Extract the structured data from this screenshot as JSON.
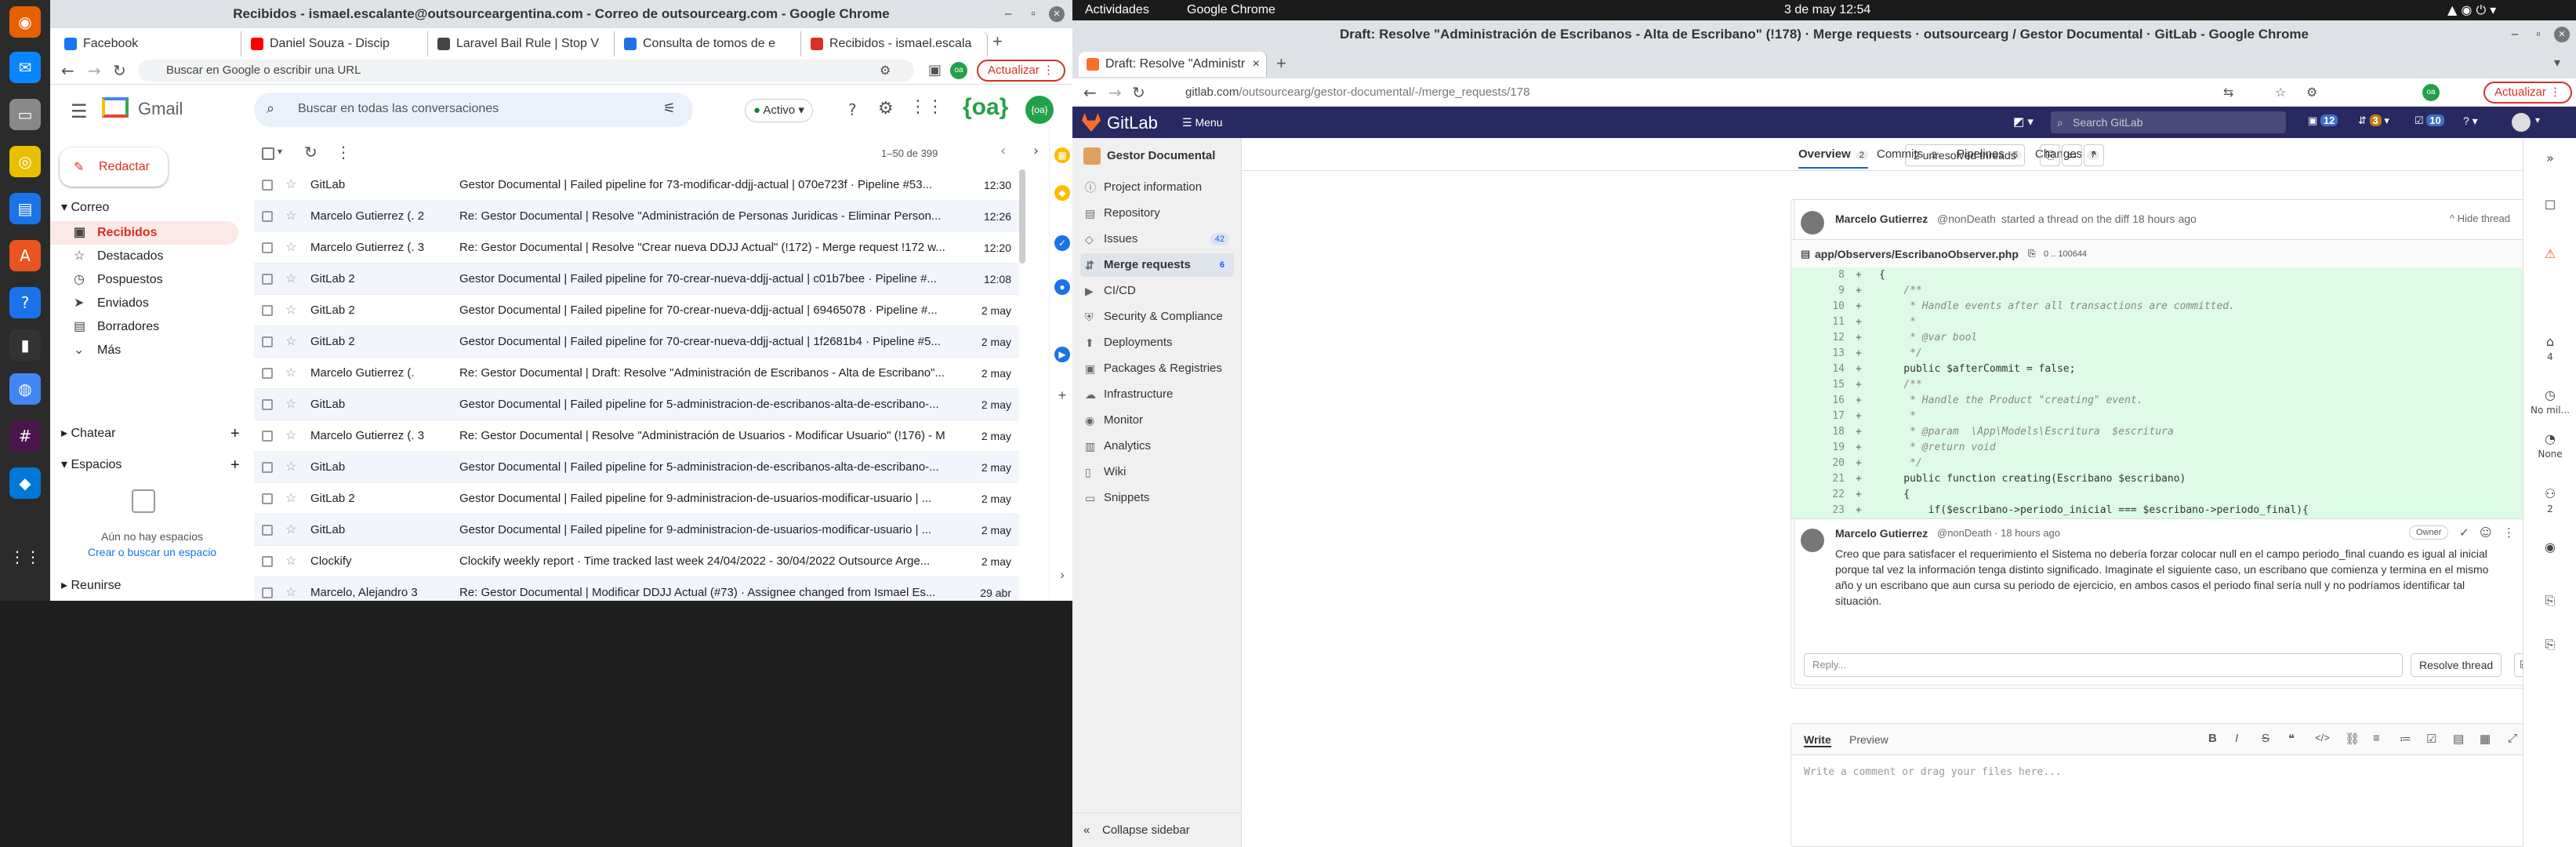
{
  "dock": {
    "icons": [
      "firefox-icon",
      "thunderbird-icon",
      "files-icon",
      "rhythmbox-icon",
      "libreoffice-icon",
      "software-icon",
      "help-icon",
      "terminal-icon",
      "chrome-icon",
      "slack-icon",
      "vscode-icon",
      "apps-grid-icon"
    ]
  },
  "gmail_window": {
    "title": "Recibidos - ismael.escalante@outsourceargentina.com - Correo de outsourcearg.com - Google Chrome",
    "tabs": [
      {
        "label": "Facebook",
        "color": "#1877f2"
      },
      {
        "label": "Daniel Souza - Discip",
        "color": "#ff0000"
      },
      {
        "label": "Laravel Bail Rule | Stop V",
        "color": "#444"
      },
      {
        "label": "Consulta de tomos de e",
        "color": "#1a73e8"
      },
      {
        "label": "Recibidos - ismael.escala",
        "color": "#d93025"
      }
    ],
    "address": "Buscar en Google o escribir una URL",
    "update_label": "Actualizar",
    "gmail_label": "Gmail",
    "search_placeholder": "Buscar en todas las conversaciones",
    "status": "Activo",
    "compose_label": "Redactar",
    "mail_header": "Correo",
    "pagination": "1–50 de 399",
    "folders": [
      "Recibidos",
      "Destacados",
      "Pospuestos",
      "Enviados",
      "Borradores",
      "Más"
    ],
    "chat_label": "Chatear",
    "spaces_label": "Espacios",
    "no_spaces": "Aún no hay espacios",
    "find_space": "Crear o buscar un espacio",
    "meet_label": "Reunirse",
    "emails": [
      {
        "from": "GitLab",
        "subject": "Gestor Documental | Failed pipeline for 73-modificar-ddjj-actual | 070e723f · Pipeline #53...",
        "date": "12:30"
      },
      {
        "from": "Marcelo Gutierrez (. 2",
        "subject": "Re: Gestor Documental | Resolve \"Administración de Personas Juridicas - Eliminar Person...",
        "date": "12:26"
      },
      {
        "from": "Marcelo Gutierrez (. 3",
        "subject": "Re: Gestor Documental | Resolve \"Crear nueva DDJJ Actual\" (!172) - Merge request !172 w...",
        "date": "12:20"
      },
      {
        "from": "GitLab 2",
        "subject": "Gestor Documental | Failed pipeline for 70-crear-nueva-ddjj-actual | c01b7bee · Pipeline #...",
        "date": "12:08"
      },
      {
        "from": "GitLab 2",
        "subject": "Gestor Documental | Failed pipeline for 70-crear-nueva-ddjj-actual | 69465078 · Pipeline #...",
        "date": "2 may"
      },
      {
        "from": "GitLab 2",
        "subject": "Gestor Documental | Failed pipeline for 70-crear-nueva-ddjj-actual | 1f2681b4 · Pipeline #5...",
        "date": "2 may"
      },
      {
        "from": "Marcelo Gutierrez (.",
        "subject": "Re: Gestor Documental | Draft: Resolve \"Administración de Escribanos - Alta de Escribano\"...",
        "date": "2 may"
      },
      {
        "from": "GitLab",
        "subject": "Gestor Documental | Failed pipeline for 5-administracion-de-escribanos-alta-de-escribano-...",
        "date": "2 may"
      },
      {
        "from": "Marcelo Gutierrez (. 3",
        "subject": "Re: Gestor Documental | Resolve \"Administración de Usuarios - Modificar Usuario\" (!176) - M",
        "date": "2 may"
      },
      {
        "from": "GitLab",
        "subject": "Gestor Documental | Failed pipeline for 5-administracion-de-escribanos-alta-de-escribano-...",
        "date": "2 may"
      },
      {
        "from": "GitLab 2",
        "subject": "Gestor Documental | Failed pipeline for 9-administracion-de-usuarios-modificar-usuario | ...",
        "date": "2 may"
      },
      {
        "from": "GitLab",
        "subject": "Gestor Documental | Failed pipeline for 9-administracion-de-usuarios-modificar-usuario | ...",
        "date": "2 may"
      },
      {
        "from": "Clockify",
        "subject": "Clockify weekly report · Time tracked last week 24/04/2022 - 30/04/2022 Outsource Arge...",
        "date": "2 may"
      },
      {
        "from": "Marcelo, Alejandro 3",
        "subject": "Re: Gestor Documental | Modificar DDJJ Actual (#73) · Assignee changed from Ismael Es...",
        "date": "29 abr"
      }
    ]
  },
  "gitlab_window": {
    "activities": "Actividades",
    "app_name": "Google Chrome",
    "clock": "3 de may  12:54",
    "title": "Draft: Resolve \"Administración de Escribanos - Alta de Escribano\" (!178) · Merge requests · outsourcearg / Gestor Documental · GitLab - Google Chrome",
    "tab": "Draft: Resolve \"Administr",
    "url_host": "gitlab.com",
    "url_path": "/outsourcearg/gestor-documental/-/merge_requests/178",
    "update_label": "Actualizar",
    "logo": "GitLab",
    "menu": "Menu",
    "search_placeholder": "Search GitLab",
    "nav_counts": [
      "12",
      "3",
      "10"
    ],
    "project": "Gestor Documental",
    "sidebar": [
      {
        "label": "Project information",
        "count": ""
      },
      {
        "label": "Repository",
        "count": ""
      },
      {
        "label": "Issues",
        "count": "42"
      },
      {
        "label": "Merge requests",
        "count": "6"
      },
      {
        "label": "CI/CD",
        "count": ""
      },
      {
        "label": "Security & Compliance",
        "count": ""
      },
      {
        "label": "Deployments",
        "count": ""
      },
      {
        "label": "Packages & Registries",
        "count": ""
      },
      {
        "label": "Infrastructure",
        "count": ""
      },
      {
        "label": "Monitor",
        "count": ""
      },
      {
        "label": "Analytics",
        "count": ""
      },
      {
        "label": "Wiki",
        "count": ""
      },
      {
        "label": "Snippets",
        "count": ""
      }
    ],
    "collapse": "Collapse sidebar",
    "mr_tabs": [
      {
        "label": "Overview",
        "count": "2"
      },
      {
        "label": "Commits",
        "count": "2"
      },
      {
        "label": "Pipelines",
        "count": "5"
      },
      {
        "label": "Changes",
        "count": "7"
      }
    ],
    "unresolved": "2 unresolved threads",
    "thread_author": "Marcelo Gutierrez",
    "thread_handle": "@nonDeath",
    "thread_action": "started a thread on the diff 18 hours ago",
    "hide_thread": "Hide thread",
    "file_path": "app/Observers/EscribanoObserver.php",
    "file_ref": "0 .. 100644",
    "code": [
      {
        "ln": "8",
        "tx": "{"
      },
      {
        "ln": "9",
        "tx": "    /**"
      },
      {
        "ln": "10",
        "tx": "     * Handle events after all transactions are committed."
      },
      {
        "ln": "11",
        "tx": "     *"
      },
      {
        "ln": "12",
        "tx": "     * @var bool"
      },
      {
        "ln": "13",
        "tx": "     */"
      },
      {
        "ln": "14",
        "tx": "    public $afterCommit = false;"
      },
      {
        "ln": "15",
        "tx": "    /**"
      },
      {
        "ln": "16",
        "tx": "     * Handle the Product \"creating\" event."
      },
      {
        "ln": "17",
        "tx": "     *"
      },
      {
        "ln": "18",
        "tx": "     * @param  \\App\\Models\\Escritura  $escritura"
      },
      {
        "ln": "19",
        "tx": "     * @return void"
      },
      {
        "ln": "20",
        "tx": "     */"
      },
      {
        "ln": "21",
        "tx": "    public function creating(Escribano $escribano)"
      },
      {
        "ln": "22",
        "tx": "    {"
      },
      {
        "ln": "23",
        "tx": "        if($escribano->periodo_inicial === $escribano->periodo_final){"
      }
    ],
    "comment_author": "Marcelo Gutierrez",
    "comment_meta": "@nonDeath · 18 hours ago",
    "owner_badge": "Owner",
    "comment_text": "Creo que para satisfacer el requerimiento el Sistema no debería forzar colocar null en el campo periodo_final cuando es igual al inicial porque tal vez la información tenga distinto significado. Imaginate el siguiente caso, un escribano que comienza y termina en el mismo año y un escribano que aun cursa su periodo de ejercicio, en ambos casos el periodo final sería null y no podríamos identificar tal situación.",
    "reply_placeholder": "Reply...",
    "resolve_label": "Resolve thread",
    "write_label": "Write",
    "preview_label": "Preview",
    "comment_placeholder": "Write a comment or drag your files here...",
    "right_labels": [
      "4",
      "No mil...",
      "None",
      "2"
    ]
  }
}
